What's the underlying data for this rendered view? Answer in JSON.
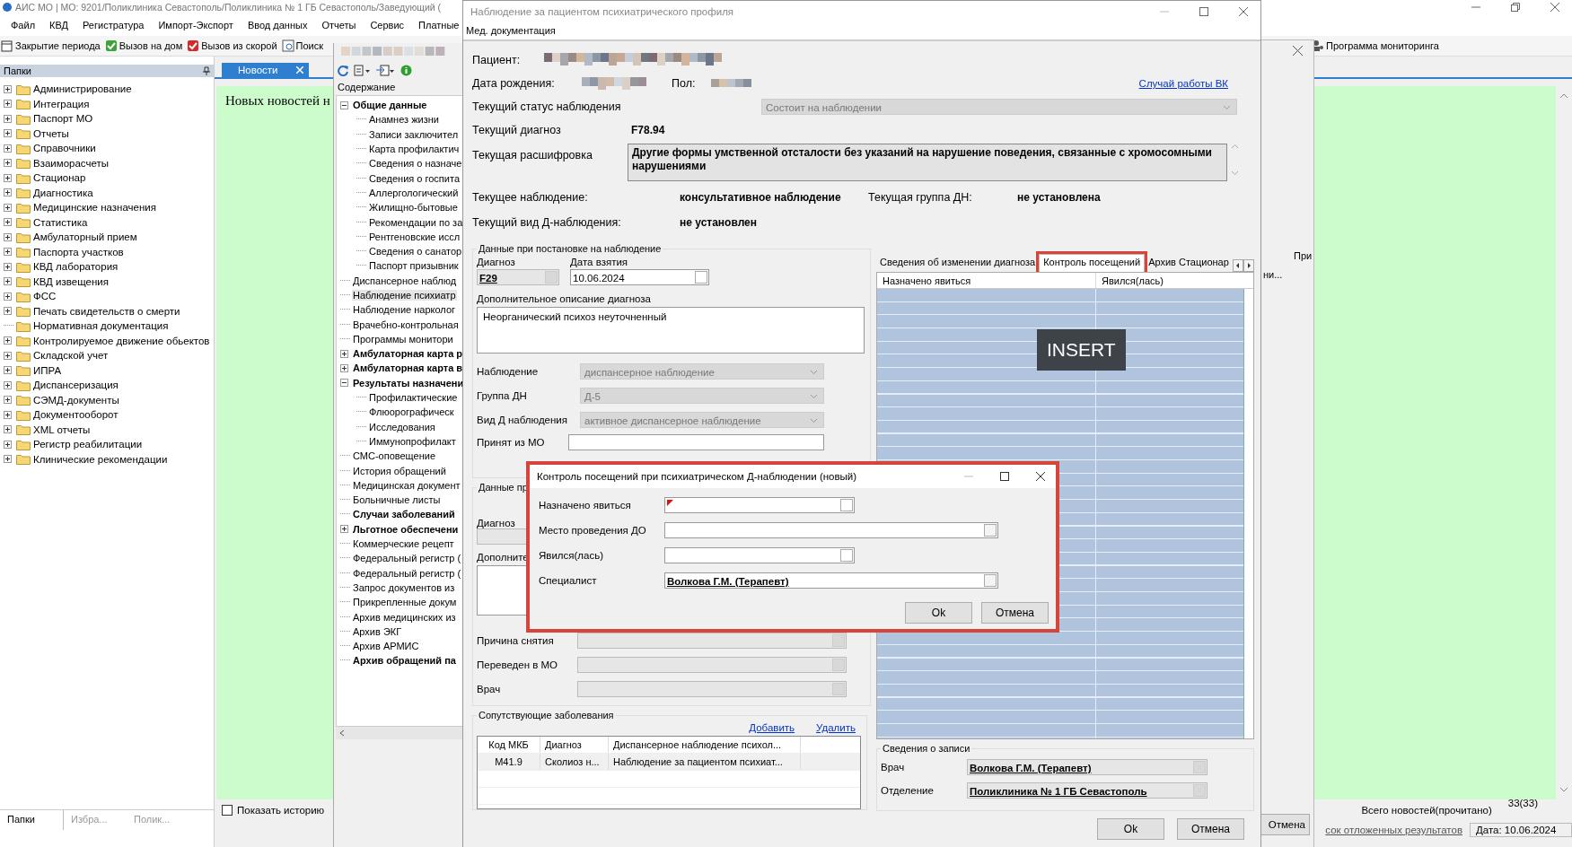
{
  "app": {
    "title": "АИС МО | МО: 9201/Поликлиника Севастополь/Поликлиника № 1 ГБ Севастополь/Заведующий (",
    "menu": [
      "Файл",
      "КВД",
      "Регистратура",
      "Импорт-Экспорт",
      "Ввод данных",
      "Отчеты",
      "Сервис",
      "Платные"
    ],
    "toolbar": [
      "Закрытие периода",
      "Вызов на дом",
      "Вызов из скорой",
      "Поиск"
    ],
    "toolbar_right": "Программа мониторинга"
  },
  "folders": {
    "title": "Папки",
    "items": [
      {
        "label": "Администрирование",
        "expandable": true
      },
      {
        "label": "Интеграция",
        "expandable": true
      },
      {
        "label": "Паспорт МО",
        "expandable": true
      },
      {
        "label": "Отчеты",
        "expandable": true
      },
      {
        "label": "Справочники",
        "expandable": true
      },
      {
        "label": "Взаиморасчеты",
        "expandable": true
      },
      {
        "label": "Стационар",
        "expandable": true
      },
      {
        "label": "Диагностика",
        "expandable": true
      },
      {
        "label": "Медицинские назначения",
        "expandable": true
      },
      {
        "label": "Статистика",
        "expandable": true
      },
      {
        "label": "Амбулаторный прием",
        "expandable": true
      },
      {
        "label": "Паспорта участков",
        "expandable": true
      },
      {
        "label": "КВД лаборатория",
        "expandable": true
      },
      {
        "label": "КВД извещения",
        "expandable": true
      },
      {
        "label": "ФСС",
        "expandable": true
      },
      {
        "label": "Печать свидетельств о смерти",
        "expandable": true
      },
      {
        "label": "Нормативная документация",
        "expandable": false
      },
      {
        "label": "Контролируемое движение обьектов",
        "expandable": true
      },
      {
        "label": "Складской учет",
        "expandable": true
      },
      {
        "label": "ИПРА",
        "expandable": true
      },
      {
        "label": "Диспансеризация",
        "expandable": true
      },
      {
        "label": "СЭМД-документы",
        "expandable": true
      },
      {
        "label": "Документооборот",
        "expandable": true
      },
      {
        "label": "XML отчеты",
        "expandable": true
      },
      {
        "label": "Регистр реабилитации",
        "expandable": true
      },
      {
        "label": "Клинические рекомендации",
        "expandable": true
      }
    ],
    "tabs": [
      {
        "label": "Папки",
        "selected": true
      },
      {
        "label": "Избра...",
        "selected": false
      },
      {
        "label": "Полик...",
        "selected": false
      }
    ]
  },
  "news": {
    "tab": "Новости",
    "text": "Новых новостей н",
    "show_history": {
      "label": "Показать историю",
      "checked": false
    },
    "total_label": "Всего новостей(прочитано)",
    "total": "33(33)"
  },
  "status_bar": {
    "link": "сок отложенных результатов",
    "date": "Дата: 10.06.2024"
  },
  "contents": {
    "title": "Содержание",
    "items": [
      {
        "label": "Общие данные",
        "bold": true,
        "selected": false,
        "expanded": true,
        "children": [
          {
            "label": "Анамнез жизни",
            "bold": false,
            "selected": false
          },
          {
            "label": "Записи заключител",
            "bold": false,
            "selected": false
          },
          {
            "label": "Карта профилактич",
            "bold": false,
            "selected": false
          },
          {
            "label": "Сведения о назначе",
            "bold": false,
            "selected": false
          },
          {
            "label": "Сведения о госпита",
            "bold": false,
            "selected": false
          },
          {
            "label": "Аллергологический",
            "bold": false,
            "selected": false
          },
          {
            "label": "Жилищно-бытовые",
            "bold": false,
            "selected": false
          },
          {
            "label": "Рекомендации по за",
            "bold": false,
            "selected": false
          },
          {
            "label": "Рентгеновские иссл",
            "bold": false,
            "selected": false
          },
          {
            "label": "Сведения о санатор",
            "bold": false,
            "selected": false
          },
          {
            "label": "Паспорт призывник",
            "bold": false,
            "selected": false
          }
        ]
      },
      {
        "label": "Диспансерное наблюд",
        "bold": false,
        "selected": false
      },
      {
        "label": "Наблюдение психиатр",
        "bold": false,
        "selected": true
      },
      {
        "label": "Наблюдение нарколог",
        "bold": false,
        "selected": false
      },
      {
        "label": "Врачебно-контрольная",
        "bold": false,
        "selected": false
      },
      {
        "label": "Программы монитори",
        "bold": false,
        "selected": false
      },
      {
        "label": "Амбулаторная карта р",
        "bold": true,
        "selected": false,
        "expanded": false
      },
      {
        "label": "Амбулаторная карта в",
        "bold": true,
        "selected": false,
        "expanded": false
      },
      {
        "label": "Результаты назначени",
        "bold": true,
        "selected": false,
        "expanded": true,
        "children": [
          {
            "label": "Профилактические",
            "bold": false,
            "selected": false
          },
          {
            "label": "Флюорографическ",
            "bold": false,
            "selected": false
          },
          {
            "label": "Исследования",
            "bold": false,
            "selected": false
          },
          {
            "label": "Иммунопрофилакт",
            "bold": false,
            "selected": false
          }
        ]
      },
      {
        "label": "СМС-оповещение",
        "bold": false,
        "selected": false
      },
      {
        "label": "История обращений",
        "bold": false,
        "selected": false
      },
      {
        "label": "Медицинская документ",
        "bold": false,
        "selected": false
      },
      {
        "label": "Больничные листы",
        "bold": false,
        "selected": false
      },
      {
        "label": "Случаи заболеваний",
        "bold": true,
        "selected": false
      },
      {
        "label": "Льготное обеспечени",
        "bold": true,
        "selected": false,
        "expanded": false
      },
      {
        "label": "Коммерческие рецепт",
        "bold": false,
        "selected": false
      },
      {
        "label": "Федеральный регистр (",
        "bold": false,
        "selected": false
      },
      {
        "label": "Федеральный регистр (",
        "bold": false,
        "selected": false
      },
      {
        "label": "Запрос документов из",
        "bold": false,
        "selected": false
      },
      {
        "label": "Прикрепленные докум",
        "bold": false,
        "selected": false
      },
      {
        "label": "Архив медицинских из",
        "bold": false,
        "selected": false
      },
      {
        "label": "Архив ЭКГ",
        "bold": false,
        "selected": false
      },
      {
        "label": "Архив АРМИС",
        "bold": false,
        "selected": false
      },
      {
        "label": "Архив обращений па",
        "bold": true,
        "selected": false
      }
    ]
  },
  "behind_window": {
    "column": "При",
    "cell": "ни...",
    "button": "Отмена"
  },
  "dialog": {
    "title": "Наблюдение за пациентом психиатрического профиля",
    "menu": "Мед. документация",
    "patient_label": "Пациент:",
    "birth_label": "Дата рождения:",
    "sex_label": "Пол:",
    "vk_link": "Случай работы ВК",
    "status": {
      "label": "Текущий статус наблюдения",
      "value": "Состоит на наблюдении"
    },
    "diagnosis": {
      "label": "Текущий диагноз",
      "value": "F78.94"
    },
    "decoding": {
      "label": "Текущая расшифровка",
      "value": "Другие формы умственной отсталости без указаний на нарушение поведения, связанные с хромосомными нарушениями"
    },
    "observation": {
      "label": "Текущее наблюдение:",
      "value": "консультативное наблюдение"
    },
    "dn_group": {
      "label": "Текущая группа ДН:",
      "value": "не установлена"
    },
    "d_type": {
      "label": "Текущий вид Д-наблюдения:",
      "value": "не установлен"
    },
    "registration": {
      "title": "Данные при постановке на наблюдение",
      "diagnosis_label": "Диагноз",
      "diagnosis": "F29",
      "date_label": "Дата взятия",
      "date": "10.06.2024",
      "description_label": "Дополнительное описание диагноза",
      "description": "Неорганический психоз неуточненный",
      "combos": [
        {
          "label": "Наблюдение",
          "value": "диспансерное наблюдение"
        },
        {
          "label": "Группа ДН",
          "value": "Д-5"
        },
        {
          "label": "Вид Д наблюдения",
          "value": "активное диспансерное наблюдение"
        }
      ],
      "from_mo_label": "Принят из МО"
    },
    "deregistration": {
      "title": "Данные пр",
      "diagnosis_label": "Диагноз",
      "description_label": "Дополните",
      "fields": [
        {
          "label": "Причина снятия"
        },
        {
          "label": "Переведен в МО"
        },
        {
          "label": "Врач"
        }
      ]
    },
    "comorbid": {
      "title": "Сопутствующие заболевания",
      "links": [
        "Добавить",
        "Удалить"
      ],
      "columns": [
        "Код МКБ",
        "Диагноз",
        "Диспансерное наблюдение психол..."
      ],
      "rows": [
        [
          "M41.9",
          "Сколиоз н...",
          "Наблюдение за пациентом психиат..."
        ]
      ]
    },
    "tabs": [
      {
        "label": "Сведения об изменении диагноза",
        "selected": false,
        "highlighted": false
      },
      {
        "label": "Контроль посещений",
        "selected": true,
        "highlighted": true
      },
      {
        "label": "Архив Стационар",
        "selected": false,
        "highlighted": false
      }
    ],
    "grid": {
      "columns": [
        "Назначено явиться",
        "Явился(лась)"
      ]
    },
    "insert_badge": "INSERT",
    "record": {
      "title": "Сведения о записи",
      "fields": [
        {
          "label": "Врач",
          "value": "Волкова Г.М. (Терапевт)"
        },
        {
          "label": "Отделение",
          "value": "Поликлиника № 1 ГБ Севастополь"
        }
      ]
    },
    "buttons": [
      "Ok",
      "Отмена"
    ]
  },
  "popup": {
    "title": "Контроль посещений при психиатрическом Д-наблюдении (новый)",
    "highlighted": true,
    "fields": [
      {
        "kind": "date",
        "label": "Назначено явиться",
        "required": true
      },
      {
        "kind": "lookup",
        "label": "Место проведения ДО",
        "required": false
      },
      {
        "kind": "date",
        "label": "Явился(лась)",
        "required": false
      },
      {
        "kind": "lookup",
        "label": "Специалист",
        "value": "Волкова Г.М. (Терапевт)",
        "required": false
      }
    ],
    "buttons": [
      "Ok",
      "Отмена"
    ]
  }
}
